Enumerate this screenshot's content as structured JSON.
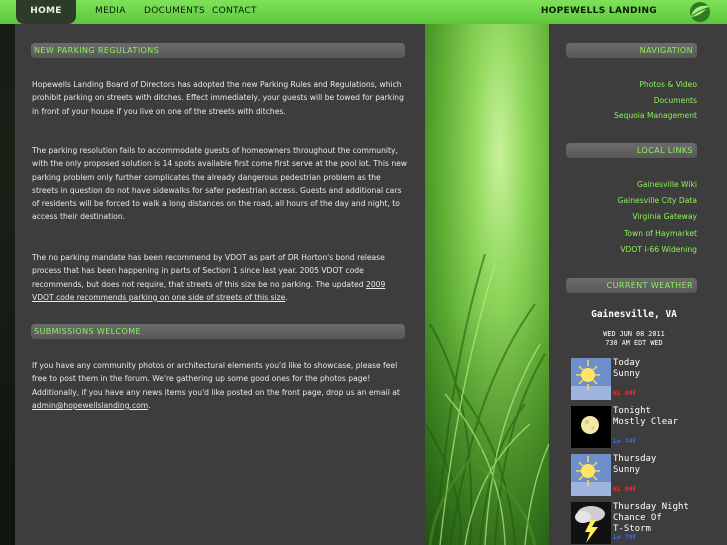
{
  "nav": {
    "items": [
      {
        "label": "HOME"
      },
      {
        "label": "MEDIA"
      },
      {
        "label": "DOCUMENTS"
      },
      {
        "label": "CONTACT"
      }
    ],
    "site_title": "HOPEWELLS LANDING"
  },
  "main": {
    "sections": [
      {
        "title": "NEW PARKING REGULATIONS",
        "paragraphs": [
          "Hopewells Landing Board of Directors has adopted the new Parking Rules and Regulations, which prohibit parking on streets with ditches. Effect immediately, your guests will be towed for parking in front of your house if you live on one of the streets with ditches.",
          "The parking resolution fails to accommodate guests of homeowners throughout the community, with the only proposed solution is 14 spots available first come first serve at the pool lot. This new parking problem only further complicates the already dangerous pedestrian problem as the streets in question do not have sidewalks for safer pedestrian access. Guests and additional cars of residents will be forced to walk a long distances on the road, all hours of the day and night, to access their destination.",
          "The no parking mandate has been recommend by VDOT as part of DR Horton's bond release process that has been happening in parts of Section 1 since last year. 2005 VDOT code recommends, but does not require, that streets of this size be no parking. The updated"
        ],
        "link_text": "2009 VDOT code recommends parking on one side of streets of this size",
        "link_suffix": "."
      },
      {
        "title": "SUBMISSIONS WELCOME",
        "paragraphs": [
          "If you have any community photos or architectural elements you'd like to showcase, please feel free to post them in the forum. We're gathering up some good ones for the photos page! Additionally, if you have any news items you'd like posted on the front page, drop us an email at"
        ],
        "email": "admin@hopewellslanding.com",
        "email_suffix": "."
      }
    ]
  },
  "sidebar": {
    "navigation": {
      "title": "NAVIGATION",
      "links": [
        "Photos & Video",
        "Documents",
        "Sequoia Management"
      ]
    },
    "local_links": {
      "title": "LOCAL LINKS",
      "links": [
        "Gainesville Wiki",
        "Gainesville City Data",
        "Virginia Gateway",
        "Town of Haymarket",
        "VDOT I-66 Widening"
      ]
    },
    "weather": {
      "title": "CURRENT WEATHER",
      "city": "Gainesville, VA",
      "date": "WED JUN 08 2011",
      "time": "730 AM EDT WED",
      "forecast": [
        {
          "label": "Today\nSunny",
          "temp": "Hi 89F",
          "temp_color": "#ff2a2a",
          "icon": "sunny-icon"
        },
        {
          "label": "Tonight\nMostly Clear",
          "temp": "Lo 74F",
          "temp_color": "#3a6bff",
          "icon": "moon-icon"
        },
        {
          "label": "Thursday\nSunny",
          "temp": "Hi 99F",
          "temp_color": "#ff2a2a",
          "icon": "sunny-icon"
        },
        {
          "label": "Thursday Night\nChance Of\nT-Storm",
          "temp": "Lo 79F",
          "temp_color": "#3a6bff",
          "icon": "thunderstorm-icon"
        }
      ]
    }
  },
  "colors": {
    "accent_green": "#8ef25c",
    "nav_bar_green": "#6fd84b",
    "panel_gray": "#3d3d3d",
    "section_bar_gray": "#626262"
  }
}
